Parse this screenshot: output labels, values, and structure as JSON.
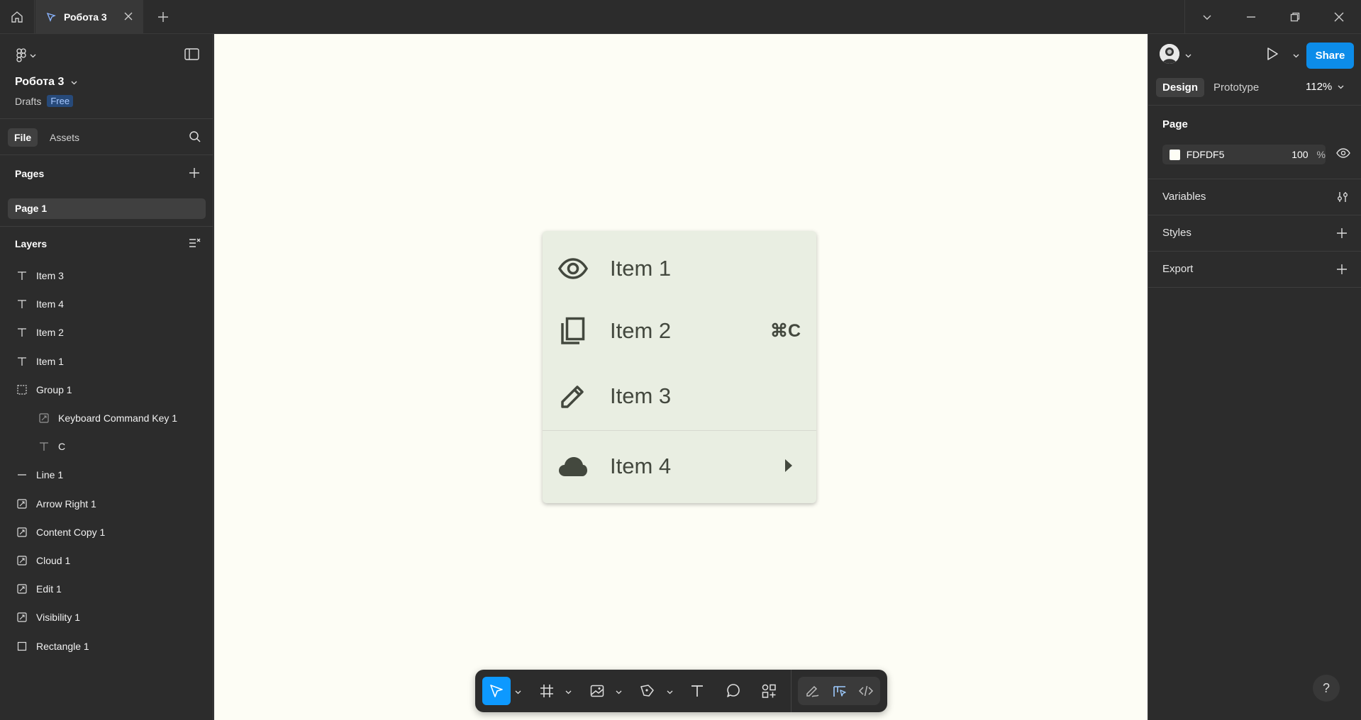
{
  "titlebar": {
    "tab_title": "Робота 3"
  },
  "file": {
    "name": "Робота 3",
    "location": "Drafts",
    "plan_badge": "Free"
  },
  "left_tabs": [
    "File",
    "Assets"
  ],
  "pages": {
    "title": "Pages",
    "items": [
      "Page 1"
    ]
  },
  "layers": {
    "title": "Layers",
    "items": [
      {
        "name": "Item 3",
        "icon": "text-icon",
        "indent": 0
      },
      {
        "name": "Item 4",
        "icon": "text-icon",
        "indent": 0
      },
      {
        "name": "Item 2",
        "icon": "text-icon",
        "indent": 0
      },
      {
        "name": "Item 1",
        "icon": "text-icon",
        "indent": 0
      },
      {
        "name": "Group 1",
        "icon": "group-icon",
        "indent": 0
      },
      {
        "name": "Keyboard Command Key 1",
        "icon": "vector-icon",
        "indent": 1
      },
      {
        "name": "C",
        "icon": "text-icon",
        "indent": 1
      },
      {
        "name": "Line 1",
        "icon": "line-icon",
        "indent": 0
      },
      {
        "name": "Arrow Right 1",
        "icon": "vector-icon",
        "indent": 0
      },
      {
        "name": "Content Copy 1",
        "icon": "vector-icon",
        "indent": 0
      },
      {
        "name": "Cloud 1",
        "icon": "vector-icon",
        "indent": 0
      },
      {
        "name": "Edit 1",
        "icon": "vector-icon",
        "indent": 0
      },
      {
        "name": "Visibility 1",
        "icon": "vector-icon",
        "indent": 0
      },
      {
        "name": "Rectangle 1",
        "icon": "rectangle-icon",
        "indent": 0
      }
    ]
  },
  "canvas": {
    "background": "#FDFDF5",
    "menu": {
      "background": "#E9EEE2",
      "text_color": "#43483E",
      "items": [
        {
          "label": "Item 1",
          "icon": "visibility-icon",
          "shortcut": ""
        },
        {
          "label": "Item 2",
          "icon": "content-copy-icon",
          "shortcut": "⌘C"
        },
        {
          "label": "Item 3",
          "icon": "edit-icon",
          "shortcut": ""
        },
        {
          "label": "Item 4",
          "icon": "cloud-icon",
          "shortcut": ""
        }
      ]
    }
  },
  "right_panel": {
    "share_label": "Share",
    "tabs": [
      "Design",
      "Prototype"
    ],
    "zoom": "112%",
    "page_section": {
      "title": "Page",
      "fill_hex": "FDFDF5",
      "opacity": "100",
      "opacity_unit": "%"
    },
    "sections": [
      "Variables",
      "Styles",
      "Export"
    ]
  },
  "colors": {
    "accent": "#0D99FF",
    "share_button": "#0C8CE9"
  }
}
